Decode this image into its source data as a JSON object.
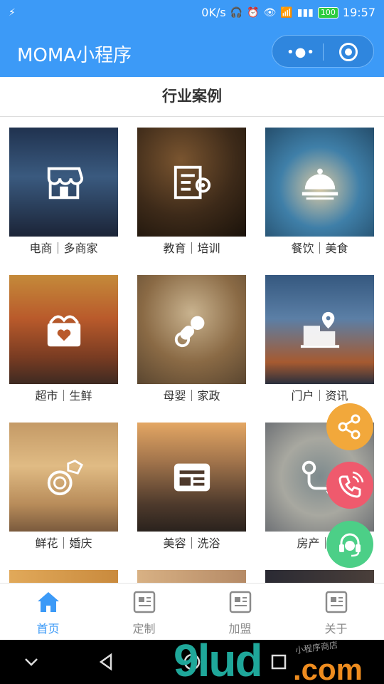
{
  "status_bar": {
    "speed": "0K/s",
    "battery": "100",
    "time": "19:57"
  },
  "app_bar": {
    "title": "MOMA小程序"
  },
  "section": {
    "title": "行业案例"
  },
  "cards": [
    {
      "label": "电商｜多商家",
      "icon": "store-icon"
    },
    {
      "label": "教育｜培训",
      "icon": "certificate-icon"
    },
    {
      "label": "餐饮｜美食",
      "icon": "food-cloche-icon"
    },
    {
      "label": "超市｜生鲜",
      "icon": "gift-box-icon"
    },
    {
      "label": "母婴｜家政",
      "icon": "pacifier-icon"
    },
    {
      "label": "门户｜资讯",
      "icon": "building-location-icon"
    },
    {
      "label": "鲜花｜婚庆",
      "icon": "diamond-ring-icon"
    },
    {
      "label": "美容｜洗浴",
      "icon": "card-icon"
    },
    {
      "label": "房产｜家",
      "icon": "route-icon"
    }
  ],
  "floating_buttons": [
    {
      "name": "share",
      "icon": "share-icon",
      "color": "#f2a83b"
    },
    {
      "name": "phone",
      "icon": "phone-icon",
      "color": "#ef5a6d"
    },
    {
      "name": "service",
      "icon": "headset-icon",
      "color": "#4ccf87"
    }
  ],
  "tabs": [
    {
      "label": "首页",
      "active": true,
      "icon": "home-icon"
    },
    {
      "label": "定制",
      "active": false,
      "icon": "document-icon"
    },
    {
      "label": "加盟",
      "active": false,
      "icon": "document-icon"
    },
    {
      "label": "关于",
      "active": false,
      "icon": "document-icon"
    }
  ],
  "watermark": {
    "main": "9lud",
    "suffix": ".com",
    "tagline": "小程序商店"
  },
  "colors": {
    "primary": "#3c9af7",
    "tab_inactive": "#8a8a8a",
    "text": "#333333"
  }
}
